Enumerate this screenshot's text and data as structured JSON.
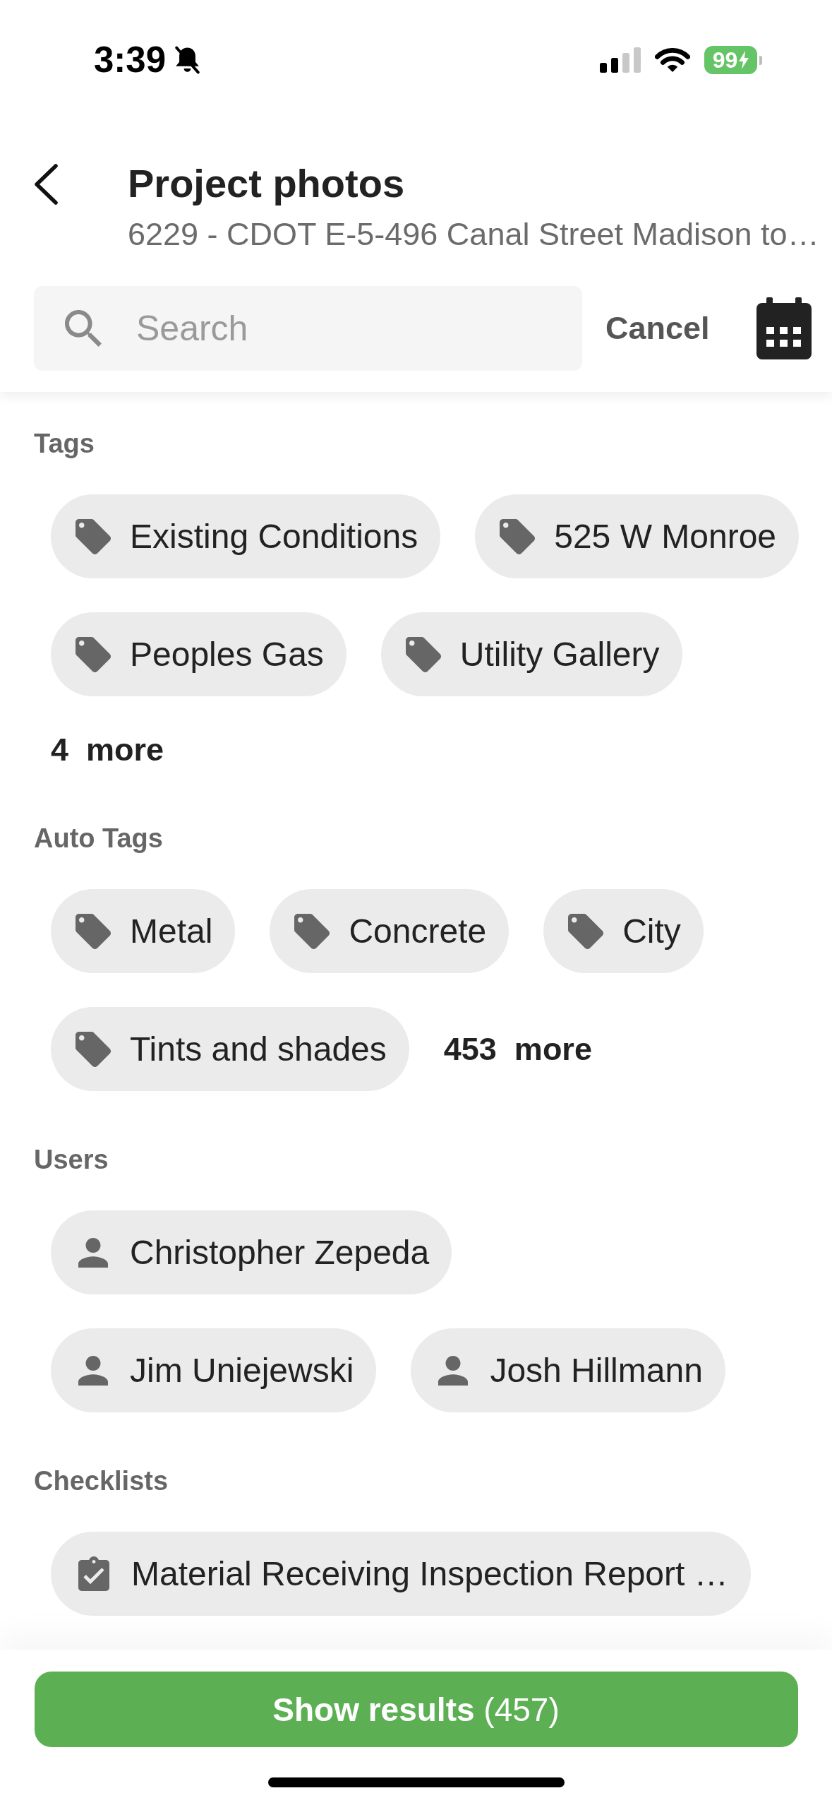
{
  "status_bar": {
    "time": "3:39",
    "battery": "99"
  },
  "header": {
    "title": "Project photos",
    "subtitle": "6229 - CDOT E-5-496 Canal Street Madison to…"
  },
  "search": {
    "placeholder": "Search",
    "cancel": "Cancel"
  },
  "sections": [
    {
      "title": "Tags",
      "kind": "tag",
      "chips": [
        "Existing Conditions",
        "525 W Monroe",
        "Peoples Gas",
        "Utility Gallery"
      ],
      "more": "4  more"
    },
    {
      "title": "Auto Tags",
      "kind": "tag",
      "chips": [
        "Metal",
        "Concrete",
        "City",
        "Tints and shades"
      ],
      "more": "453  more"
    },
    {
      "title": "Users",
      "kind": "user",
      "chips": [
        "Christopher Zepeda",
        "Jim Uniejewski",
        "Josh Hillmann"
      ]
    },
    {
      "title": "Checklists",
      "kind": "checklist",
      "chips": [
        "Material Receiving Inspection Report …"
      ]
    }
  ],
  "show_results_button": "**Show results** (457)"
}
